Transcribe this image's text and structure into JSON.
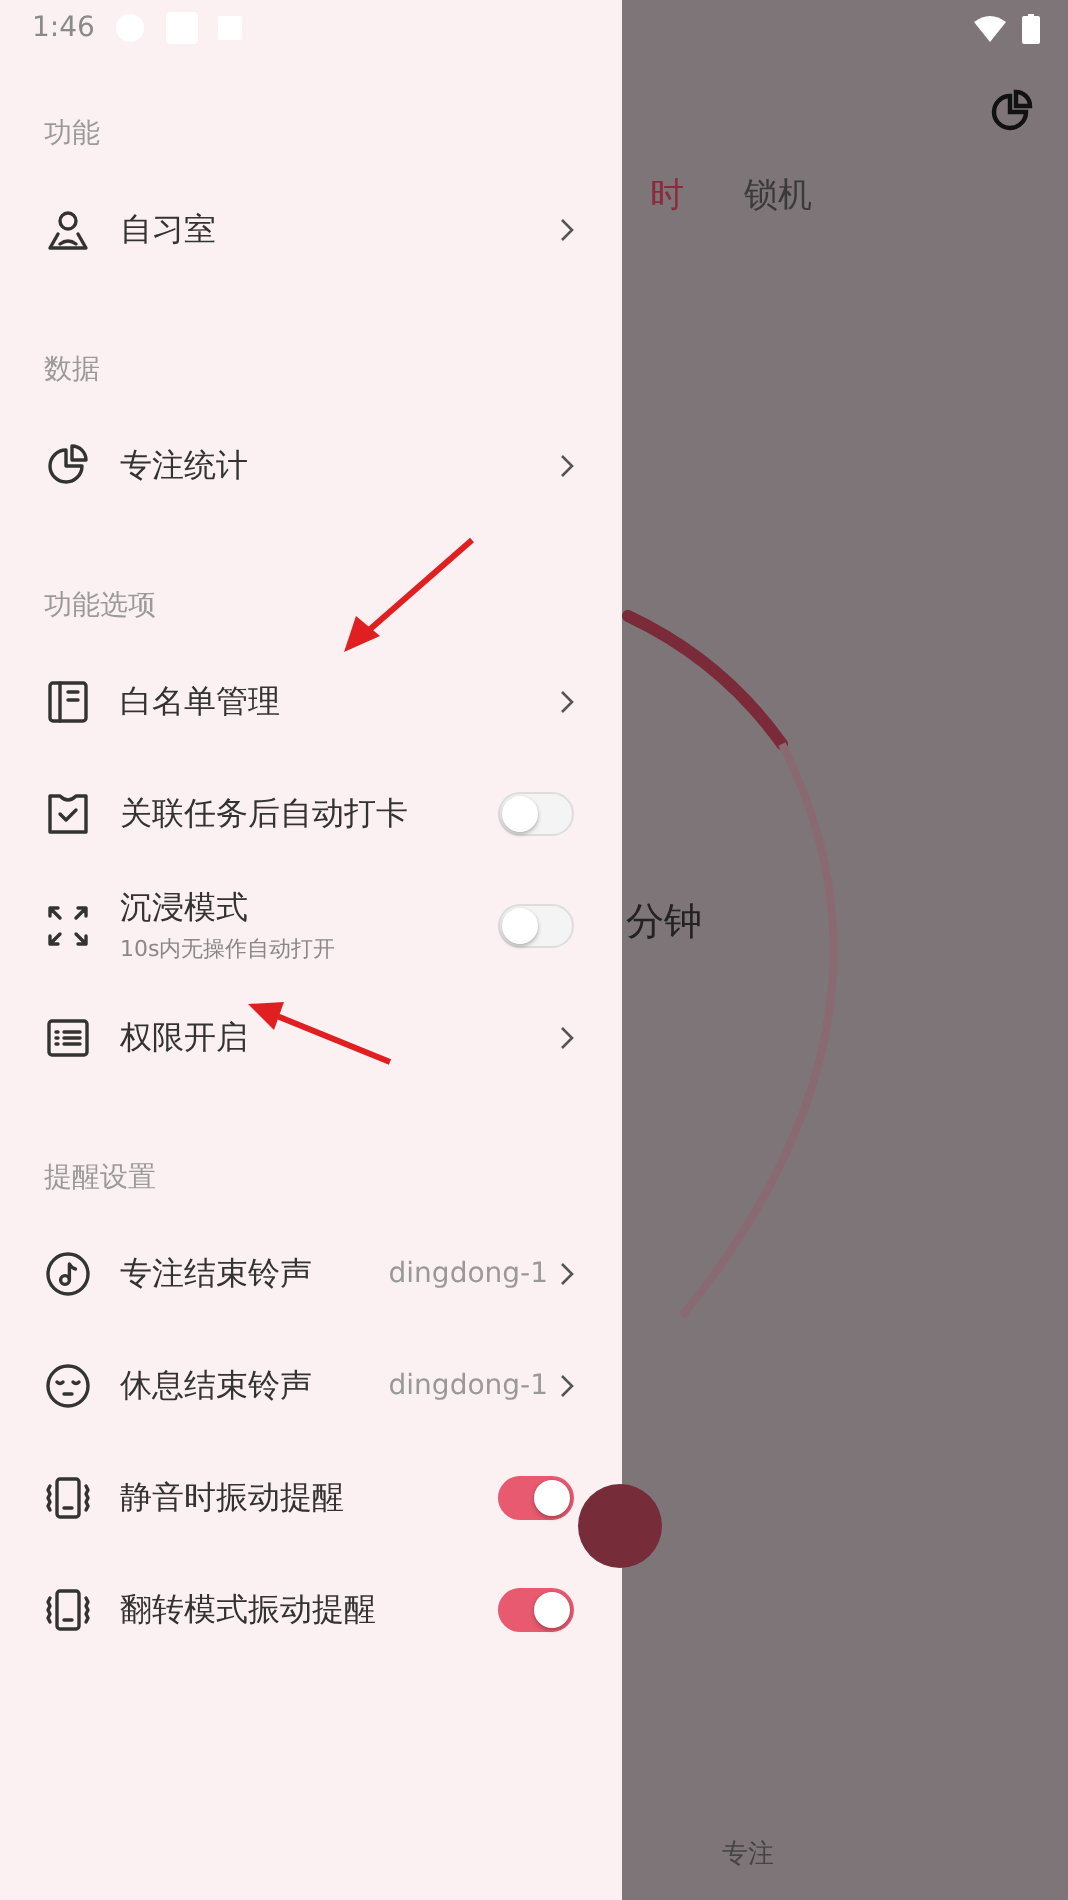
{
  "status_bar": {
    "time": "1:46"
  },
  "drawer": {
    "sections": [
      {
        "title": "功能",
        "items": [
          {
            "kind": "link",
            "label": "自习室"
          }
        ]
      },
      {
        "title": "数据",
        "items": [
          {
            "kind": "link",
            "label": "专注统计"
          }
        ]
      },
      {
        "title": "功能选项",
        "items": [
          {
            "kind": "link",
            "label": "白名单管理"
          },
          {
            "kind": "toggle",
            "label": "关联任务后自动打卡",
            "on": false
          },
          {
            "kind": "toggle",
            "label": "沉浸模式",
            "subtitle": "10s内无操作自动打开",
            "on": false
          },
          {
            "kind": "link",
            "label": "权限开启"
          }
        ]
      },
      {
        "title": "提醒设置",
        "items": [
          {
            "kind": "value",
            "label": "专注结束铃声",
            "value": "dingdong-1"
          },
          {
            "kind": "value",
            "label": "休息结束铃声",
            "value": "dingdong-1"
          },
          {
            "kind": "toggle",
            "label": "静音时振动提醒",
            "on": true
          },
          {
            "kind": "toggle",
            "label": "翻转模式振动提醒",
            "on": true
          }
        ]
      }
    ]
  },
  "background": {
    "tabs": [
      {
        "label": "时",
        "selected": true
      },
      {
        "label": "锁机",
        "selected": false
      }
    ],
    "timer_unit": "分钟",
    "bottom_tab": "专注"
  }
}
